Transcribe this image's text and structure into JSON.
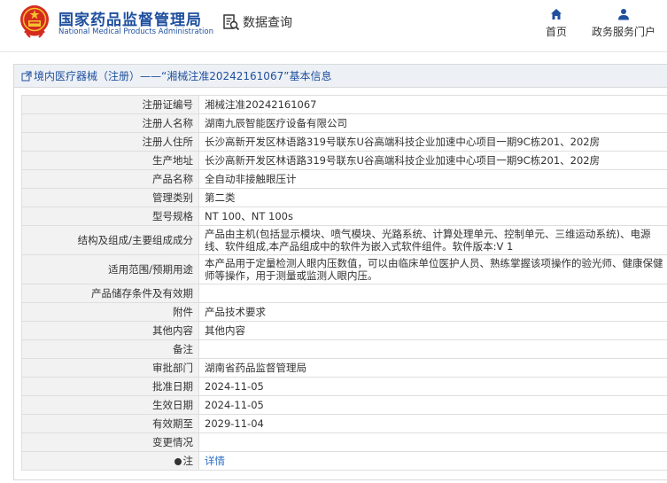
{
  "header": {
    "brand_cn": "国家药品监督管理局",
    "brand_en": "National Medical Products Administration",
    "data_search": "数据查询",
    "nav": {
      "home": "首页",
      "gov_portal": "政务服务门户"
    },
    "accent_color": "#1f4f9e",
    "emblem_color": "#d52b1e"
  },
  "page": {
    "title_prefix": "境内医疗器械（注册）",
    "title_dash": "——",
    "title_quote": "“湘械注准20242161067”",
    "title_suffix": "基本信息"
  },
  "rows": [
    {
      "label": "注册证编号",
      "value": "湘械注准20242161067"
    },
    {
      "label": "注册人名称",
      "value": "湖南九辰智能医疗设备有限公司"
    },
    {
      "label": "注册人住所",
      "value": "长沙高新开发区林语路319号联东U谷高端科技企业加速中心项目一期9C栋201、202房"
    },
    {
      "label": "生产地址",
      "value": "长沙高新开发区林语路319号联东U谷高端科技企业加速中心项目一期9C栋201、202房"
    },
    {
      "label": "产品名称",
      "value": "全自动非接触眼压计"
    },
    {
      "label": "管理类别",
      "value": "第二类"
    },
    {
      "label": "型号规格",
      "value": "NT 100、NT 100s"
    },
    {
      "label": "结构及组成/主要组成成分",
      "value": "产品由主机(包括显示模块、喷气模块、光路系统、计算处理单元、控制单元、三维运动系统)、电源线、软件组成,本产品组成中的软件为嵌入式软件组件。软件版本:V 1"
    },
    {
      "label": "适用范围/预期用途",
      "value": "本产品用于定量检测人眼内压数值，可以由临床单位医护人员、熟练掌握该项操作的验光师、健康保健师等操作，用于测量或监测人眼内压。"
    },
    {
      "label": "产品储存条件及有效期",
      "value": ""
    },
    {
      "label": "附件",
      "value": "产品技术要求"
    },
    {
      "label": "其他内容",
      "value": "其他内容"
    },
    {
      "label": "备注",
      "value": ""
    },
    {
      "label": "审批部门",
      "value": "湖南省药品监督管理局"
    },
    {
      "label": "批准日期",
      "value": "2024-11-05"
    },
    {
      "label": "生效日期",
      "value": "2024-11-05"
    },
    {
      "label": "有效期至",
      "value": "2029-11-04"
    },
    {
      "label": "变更情况",
      "value": ""
    },
    {
      "label": "注",
      "value": "详情"
    }
  ]
}
